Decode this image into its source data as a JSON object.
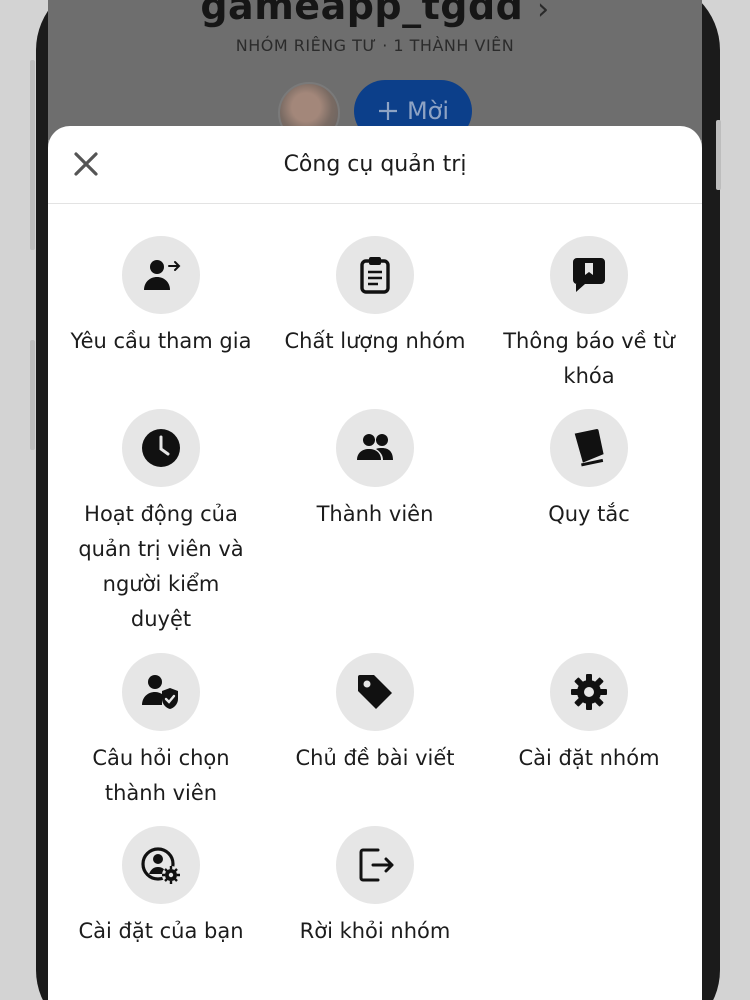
{
  "group": {
    "name": "gameapp_tgdd",
    "chevron": "›",
    "meta": "NHÓM RIÊNG TƯ · 1 THÀNH VIÊN",
    "invite_label": "Mời",
    "invite_icon": "plus-icon"
  },
  "sheet": {
    "title": "Công cụ quản trị",
    "close_icon": "close-icon"
  },
  "tools": [
    {
      "label": "Yêu cầu tham gia",
      "icon": "person-arrow-icon"
    },
    {
      "label": "Chất lượng nhóm",
      "icon": "clipboard-icon"
    },
    {
      "label": "Thông báo về từ khóa",
      "icon": "speech-bookmark-icon"
    },
    {
      "label": "Hoạt động của quản trị viên và người kiểm duyệt",
      "icon": "clock-icon"
    },
    {
      "label": "Thành viên",
      "icon": "people-icon"
    },
    {
      "label": "Quy tắc",
      "icon": "book-icon"
    },
    {
      "label": "Câu hỏi chọn thành viên",
      "icon": "person-check-icon"
    },
    {
      "label": "Chủ đề bài viết",
      "icon": "tag-icon"
    },
    {
      "label": "Cài đặt nhóm",
      "icon": "gear-icon"
    },
    {
      "label": "Cài đặt của bạn",
      "icon": "person-gear-icon"
    },
    {
      "label": "Rời khỏi nhóm",
      "icon": "exit-icon"
    }
  ]
}
